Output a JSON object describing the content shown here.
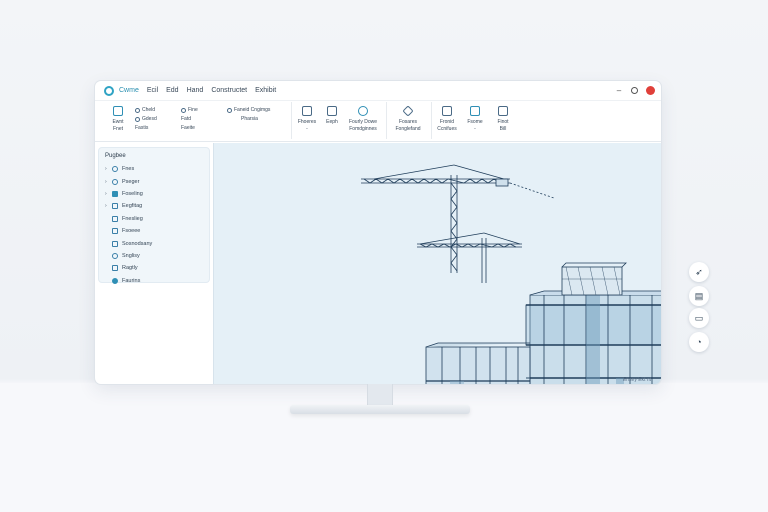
{
  "window": {
    "app_name": "Cwme",
    "menu": [
      "Ecil",
      "Edd",
      "Hand",
      "Constructet",
      "Exhibit"
    ]
  },
  "ribbon": {
    "groups": [
      {
        "tools": [
          {
            "label_top": "Ewnt",
            "label_bottom": "Fnet",
            "icon": "pencil-icon"
          },
          {
            "rows": [
              "Cheld",
              "Gdesd",
              "Fastis"
            ],
            "icon": "list-icon",
            "wide": true
          },
          {
            "rows": [
              "Fine",
              "Fatd",
              "Faeite"
            ],
            "icon": "layers-icon",
            "wide": true
          },
          {
            "rows": [
              "Faneid Cngimgs",
              "",
              "Pharsia"
            ],
            "icon": "copy-icon",
            "wide": true
          }
        ]
      },
      {
        "tools": [
          {
            "label_top": "Fhoeres",
            "label_bottom": "-",
            "icon": "brush-icon"
          },
          {
            "label_top": "Eeph",
            "label_bottom": "",
            "icon": "image-icon"
          },
          {
            "label_top": "Fourly Dowe",
            "label_bottom": "Fomdginnes",
            "icon": "globe-icon",
            "wide": true
          }
        ]
      },
      {
        "tools": [
          {
            "label_top": "Fosares",
            "label_bottom": "Fonglefand",
            "icon": "diamond-icon",
            "wide": true
          }
        ]
      },
      {
        "tools": [
          {
            "label_top": "Fronid",
            "label_bottom": "Ccnifues",
            "icon": "document-icon"
          },
          {
            "label_top": "Fsome",
            "label_bottom": "-",
            "icon": "tablet-icon"
          },
          {
            "label_top": "Finot",
            "label_bottom": "Bill",
            "icon": "panel-icon"
          }
        ]
      }
    ]
  },
  "sidebar": {
    "title": "Pugbee",
    "items": [
      {
        "label": "Fnes",
        "expandable": true,
        "icon": "globe-icon"
      },
      {
        "label": "Pseger",
        "expandable": true,
        "icon": "sphere-icon"
      },
      {
        "label": "Foseling",
        "expandable": true,
        "icon": "cube-icon"
      },
      {
        "label": "Eegfitag",
        "expandable": true,
        "icon": "folder-icon"
      },
      {
        "label": "Fneslieg",
        "expandable": false,
        "icon": "grid-icon"
      },
      {
        "label": "Fsoeee",
        "expandable": false,
        "icon": "file-icon"
      },
      {
        "label": "Sosnodsany",
        "expandable": false,
        "icon": "layers-icon"
      },
      {
        "label": "Snglisy",
        "expandable": false,
        "icon": "cog-icon"
      },
      {
        "label": "Ragtly",
        "expandable": false,
        "icon": "node-icon"
      },
      {
        "label": "Faurins",
        "expandable": false,
        "icon": "pin-icon"
      }
    ]
  },
  "viewport": {
    "footer_label": "Ensey Ekt nt"
  },
  "floating_tools": [
    {
      "icon": "navigate-icon",
      "glyph": "➶"
    },
    {
      "icon": "calendar-icon",
      "glyph": "▤"
    },
    {
      "icon": "chat-icon",
      "glyph": "▭"
    },
    {
      "icon": "comment-icon",
      "glyph": "◔"
    }
  ],
  "colors": {
    "accent": "#2fa3c4",
    "close_button": "#e0403a",
    "viewport_bg": "#e5f0f7",
    "building_line": "#1f3d5a",
    "glass": "#8fb5d0"
  }
}
